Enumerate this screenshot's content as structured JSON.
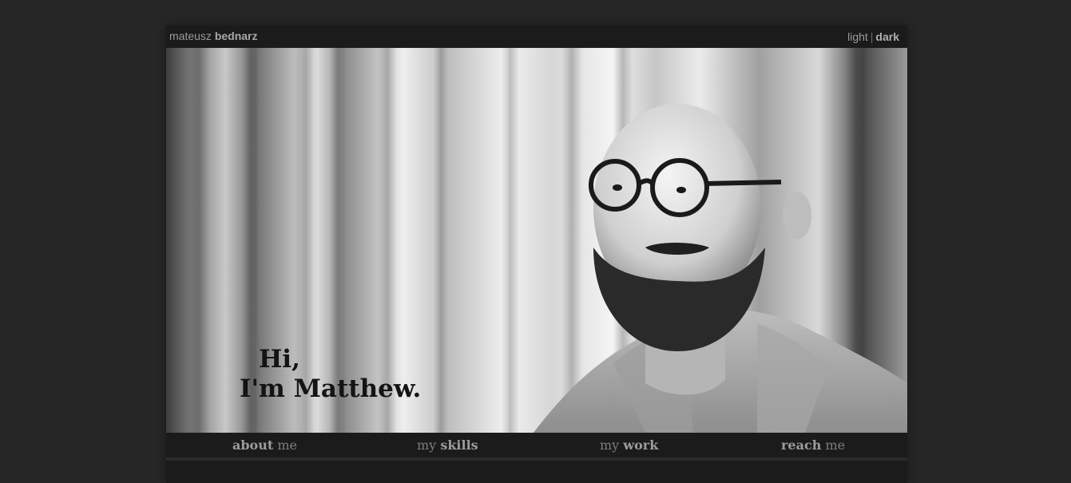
{
  "header": {
    "brand_first": "mateusz",
    "brand_last": "bednarz",
    "theme_light": "light",
    "theme_separator": "|",
    "theme_dark": "dark",
    "active_theme": "dark"
  },
  "hero": {
    "greeting_line1": "Hi,",
    "greeting_line2": "I'm Matthew.",
    "photo_icon": "portrait-photo"
  },
  "nav": {
    "items": [
      {
        "strong": "about",
        "light": "me",
        "order": "strong-first"
      },
      {
        "light": "my",
        "strong": "skills",
        "order": "light-first"
      },
      {
        "light": "my",
        "strong": "work",
        "order": "light-first"
      },
      {
        "strong": "reach",
        "light": "me",
        "order": "strong-first"
      }
    ]
  },
  "colors": {
    "page_background": "#262626",
    "panel_background": "#1b1b1b",
    "text_muted": "#9a9a9a"
  }
}
